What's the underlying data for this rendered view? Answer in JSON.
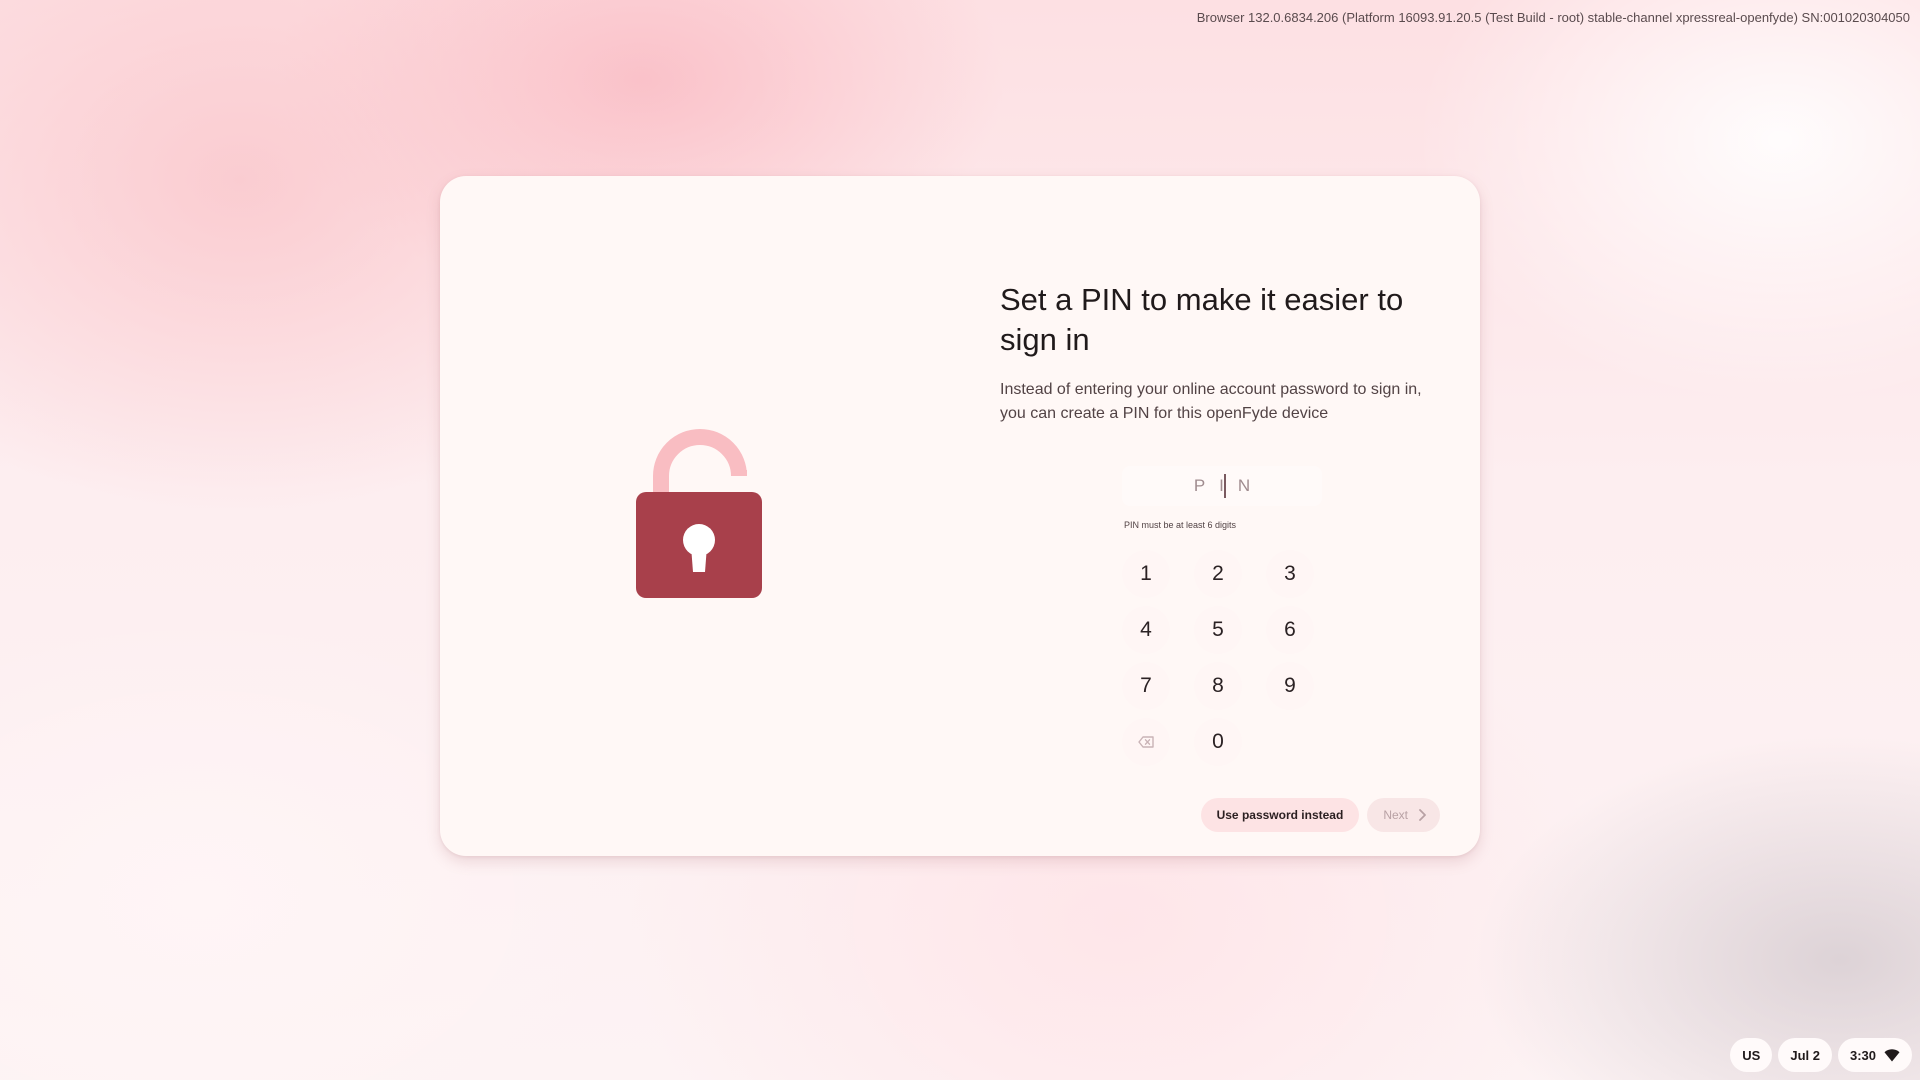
{
  "build_info": "Browser 132.0.6834.206 (Platform 16093.91.20.5 (Test Build - root) stable-channel xpressreal-openfyde) SN:001020304050",
  "dialog": {
    "title": "Set a PIN to make it easier to sign in",
    "subtitle": "Instead of entering your online account password to sign in, you can create a PIN for this openFyde device",
    "pin_field": {
      "placeholder": "PIN",
      "value": ""
    },
    "pin_hint": "PIN must be at least 6 digits",
    "keypad": {
      "keys": [
        "1",
        "2",
        "3",
        "4",
        "5",
        "6",
        "7",
        "8",
        "9",
        "0"
      ],
      "backspace_icon": "backspace-icon"
    },
    "buttons": {
      "use_password": "Use password instead",
      "next": "Next"
    },
    "illustration_icon": "unlocked-padlock-icon",
    "colors": {
      "lock_body": "#a8404b",
      "lock_shackle": "#f9bdc2",
      "dialog_background": "#fff8f6"
    }
  },
  "tray": {
    "keyboard_layout": "US",
    "date": "Jul 2",
    "time": "3:30",
    "wifi_icon": "wifi-icon"
  }
}
